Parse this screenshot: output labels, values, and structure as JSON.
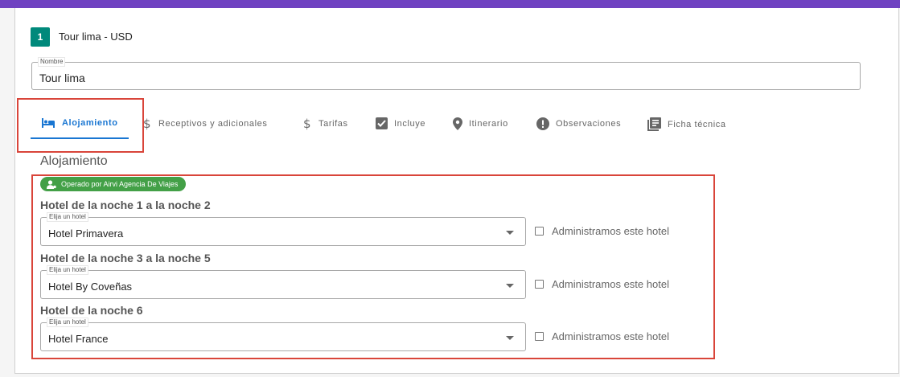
{
  "header": {
    "step_number": "1",
    "title": "Tour lima - USD"
  },
  "name_field": {
    "label": "Nombre",
    "value": "Tour lima"
  },
  "tabs": [
    {
      "label": "Alojamiento",
      "icon": "bed-icon",
      "active": true
    },
    {
      "label": "Receptivos y adicionales",
      "icon": "dollar-icon",
      "active": false
    },
    {
      "label": "Tarifas",
      "icon": "dollar-icon",
      "active": false
    },
    {
      "label": "Incluye",
      "icon": "checkbox-icon",
      "active": false
    },
    {
      "label": "Itinerario",
      "icon": "location-pin-icon",
      "active": false
    },
    {
      "label": "Observaciones",
      "icon": "alert-icon",
      "active": false
    },
    {
      "label": "Ficha técnica",
      "icon": "document-icon",
      "active": false
    }
  ],
  "section": {
    "title": "Alojamiento",
    "operator_badge": "Operado por Airvi Agencia De Viajes",
    "hotels": [
      {
        "nights_label": "Hotel de la noche 1 a la noche 2",
        "select_label": "Elija un hotel",
        "value": "Hotel Primavera",
        "checkbox_label": "Administramos este hotel",
        "checked": false
      },
      {
        "nights_label": "Hotel de la noche 3 a la noche 5",
        "select_label": "Elija un hotel",
        "value": "Hotel By Coveñas",
        "checkbox_label": "Administramos este hotel",
        "checked": false
      },
      {
        "nights_label": "Hotel de la noche 6",
        "select_label": "Elija un hotel",
        "value": "Hotel France",
        "checkbox_label": "Administramos este hotel",
        "checked": false
      }
    ]
  },
  "colors": {
    "topbar": "#6f42c1",
    "step_badge": "#00897b",
    "active_tab": "#1976d2",
    "operator_badge": "#43a047",
    "highlight": "#d9453a"
  }
}
